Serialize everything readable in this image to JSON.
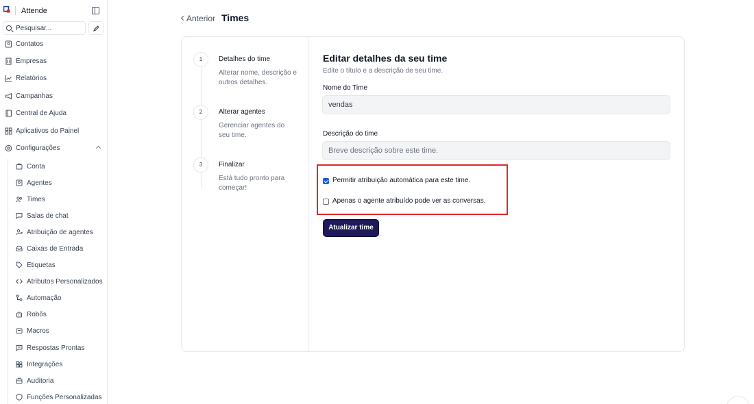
{
  "app": {
    "name": "Attende"
  },
  "search": {
    "placeholder": "Pesquisar..."
  },
  "sidebar": {
    "items": [
      {
        "label": "Contatos",
        "icon": "contacts-icon"
      },
      {
        "label": "Empresas",
        "icon": "building-icon"
      },
      {
        "label": "Relatórios",
        "icon": "chart-icon"
      },
      {
        "label": "Campanhas",
        "icon": "megaphone-icon"
      },
      {
        "label": "Central de Ajuda",
        "icon": "book-icon"
      },
      {
        "label": "Aplicativos do Painel",
        "icon": "apps-icon"
      },
      {
        "label": "Configurações",
        "icon": "gear-icon",
        "expanded": true
      }
    ],
    "settings": [
      {
        "label": "Conta",
        "icon": "account-icon"
      },
      {
        "label": "Agentes",
        "icon": "agent-icon"
      },
      {
        "label": "Times",
        "icon": "team-icon"
      },
      {
        "label": "Salas de chat",
        "icon": "chat-icon"
      },
      {
        "label": "Atribuição de agentes",
        "icon": "assign-icon"
      },
      {
        "label": "Caixas de Entrada",
        "icon": "inbox-icon"
      },
      {
        "label": "Etiquetas",
        "icon": "tag-icon"
      },
      {
        "label": "Atributos Personalizados",
        "icon": "code-icon"
      },
      {
        "label": "Automação",
        "icon": "automation-icon"
      },
      {
        "label": "Robôs",
        "icon": "bot-icon"
      },
      {
        "label": "Macros",
        "icon": "macro-icon"
      },
      {
        "label": "Respostas Prontas",
        "icon": "canned-icon"
      },
      {
        "label": "Integrações",
        "icon": "integrations-icon"
      },
      {
        "label": "Auditoria",
        "icon": "audit-icon"
      },
      {
        "label": "Funções Personalizadas",
        "icon": "shield-icon"
      }
    ]
  },
  "header": {
    "back_label": "Anterior",
    "title": "Times"
  },
  "steps": [
    {
      "number": "1",
      "title": "Detalhes do time",
      "description": "Alterar nome, descrição e outros detalhes."
    },
    {
      "number": "2",
      "title": "Alterar agentes",
      "description": "Gerenciar agentes do seu time."
    },
    {
      "number": "3",
      "title": "Finalizar",
      "description": "Está tudo pronto para começar!"
    }
  ],
  "form": {
    "title": "Editar detalhes da seu time",
    "subtitle": "Edite o título e a descrição de seu time.",
    "name_label": "Nome do Time",
    "name_value": "vendas",
    "desc_label": "Descrição do time",
    "desc_placeholder": "Breve descrição sobre este time.",
    "auto_assign_label": "Permitir atribuição automática para este time.",
    "auto_assign_checked": true,
    "only_assigned_label": "Apenas o agente atribuído pode ver as conversas.",
    "only_assigned_checked": false,
    "submit_label": "Atualizar time"
  },
  "colors": {
    "primary": "#1f1b5a",
    "highlight": "#e0262a",
    "checkbox": "#1d5bd8"
  }
}
